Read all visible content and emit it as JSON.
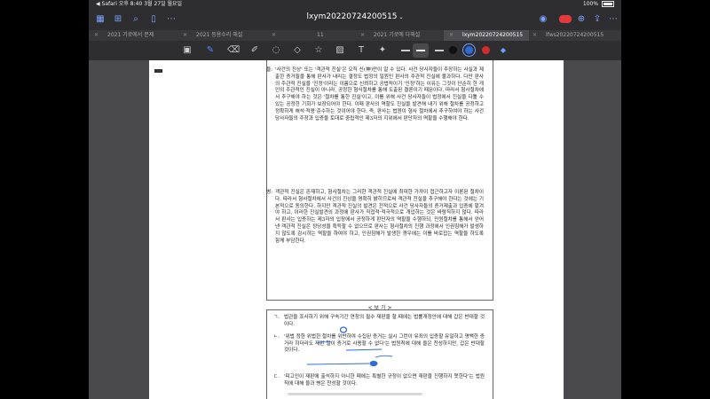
{
  "status": {
    "carrier": "◀ Safari",
    "time": "오후 8:40",
    "date": "3월 27일 월요일",
    "battery": "100%"
  },
  "navbar": {
    "title": "lxym20220724200515",
    "chevron": "⌄"
  },
  "tabs": [
    {
      "label": "2021 기로에서 문제",
      "active": false
    },
    {
      "label": "2021 등용수리 해설",
      "active": false
    },
    {
      "label": "11",
      "active": false
    },
    {
      "label": "2021 기로에 다해설",
      "active": false
    },
    {
      "label": "lxym20220724200515",
      "active": true
    },
    {
      "label": "lfws20220724200515",
      "active": false
    }
  ],
  "tools": [
    "page-thumbnail",
    "pen",
    "eraser",
    "highlighter",
    "lasso",
    "shapes",
    "sticker",
    "image",
    "textbox",
    "laser"
  ],
  "colors": {
    "black": "#111111",
    "blue": "#2f6bd6",
    "red": "#d42a2a",
    "accent": "#4f8bff"
  },
  "paragraphs": [
    {
      "marker": "을:",
      "text": "'사건의 진상'  또는  '객관적 진실'은 오직 신(神)만이 알 수 있다. 사건 당사자들이 주장하는 사실과 제출한 증거들을 통해 판사가 내리는 결정도 법정의 일원인 판사의 주관적 진실에 불과하다. 다만 판사의 주관적 진실을 '진정'이라는 이름으로 신뢰하고 공법적이기 '인정'하는 이유는 그것이 단순히 한 개인의 주관적인 진실이 아니라, 공정한 형식절차를 통해 도출된 결론이기 때문이다. 따라서 형사절차에서 추구해야 하는 것은 '절차를 통한 진실'이고, 이를 위해 사건 당사자들이 법정에서 진실을 다툴 수 있는 공정한 기회가 보장되어야 한다. 이때 판사의 역할도 진실을 발견해 내기 위해 절차를 공정하고 정확하게 해석·적용·준수하는 것이어야 한다. 즉, 판사는 법원이 형사 절차에서 추구하여야 하는 사건 당사자들의 주장과 입증을 토대로 중립적인 제3자의 지위에서 판단자의 역할을 수행해야 한다."
    },
    {
      "marker": "병:",
      "text": "객관적 진실은 존재하고, 형사절차는 그러한 객관적 진실에 최대한 가까이 접근하고자 이론된 절차이다. 따라서 형사절차에서 사건의 진상을 명확히 밝히므로써 객관적 진실을 추구해야 한다는 것에는 기본적으로 동의한다. 하지만 객관적 진실의 발견은 전적으로 사건 당사자들의 증거제출과 입증에 맡겨야 하고, 이러한 진실발견의 과정에 판사가 직접적·적극적으로 개입하는 것은 바람직하지 않다. 따라서 판사는 입증하는 제3자의 입장에서 공정하게 판단자의 역할을 수행하되, 민원절차를 통해서 얻어낸 객관적 진실은 정당성을 획득할 수 없으므로 판사는 형사절차의 진행 과정에서 인권침해가 발생하지 않도록 감시하는 역할을 하여야 하고, 인권침해가 발생한 경우에는 이를 바로잡는 역할을 하도록 함께 부담한다."
    }
  ],
  "box_label": "< 보  기 >",
  "items": [
    {
      "marker": "ㄱ.",
      "text": "법관을 조사하기 위해 구속기간 연장의 필수 재판을 할 때에는 법률개정안에 대해 갑은 반대할 것이다."
    },
    {
      "marker": "ㄴ.",
      "text": "'위법 정한 위법한 절차를 위반하여 수집된 증거는 실시 그런이 유죄의 입증할 유일하고 명백한 증거라 하더라도 재판 절이 증거로 사용할 수 없다'는 법원칙에 대해 을은 찬성하지만, 갑은 반대할 것이다."
    },
    {
      "marker": "ㄷ.",
      "text": "'피고인이 재판에 출석하지 아니한 때에는 특별한 규정이 없으면 재판을 진행하지 못한다'는 법원칙에 대해 을과 병은 찬성할 것이다."
    }
  ]
}
